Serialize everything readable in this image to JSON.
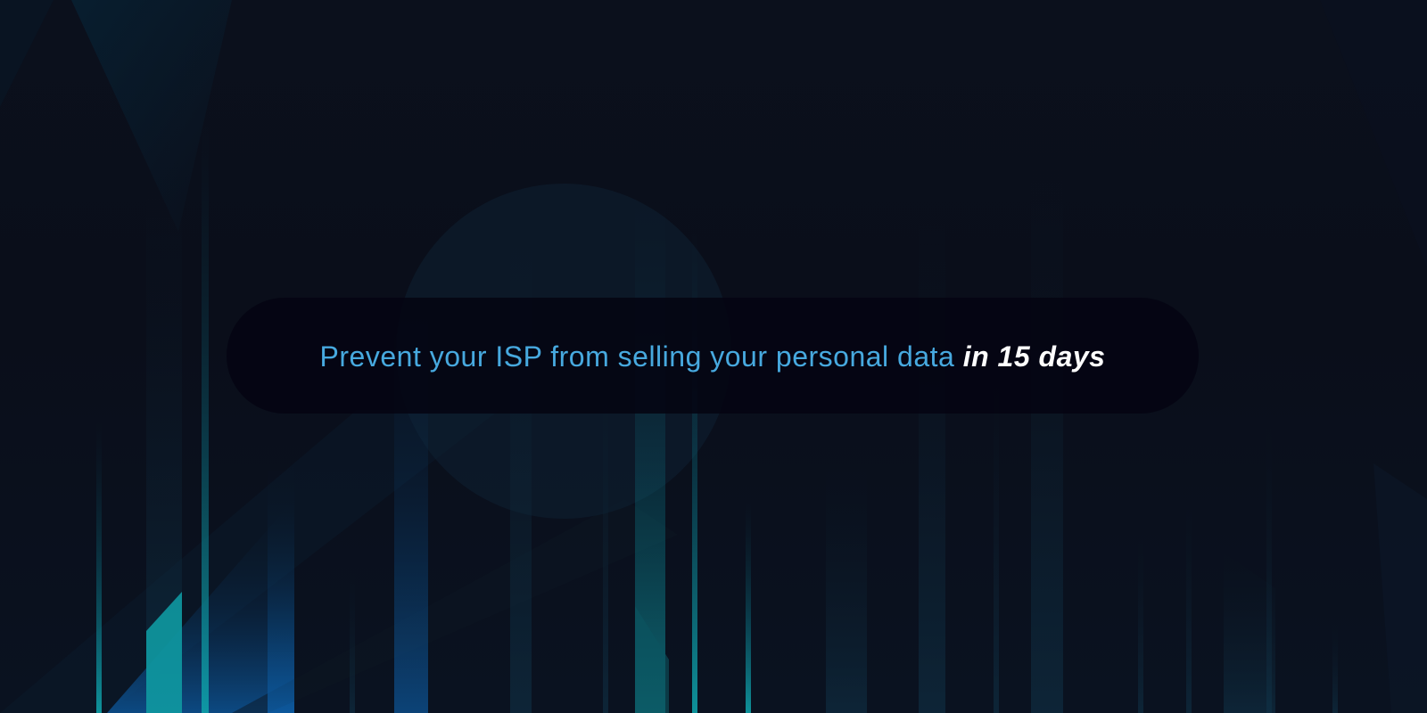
{
  "banner": {
    "headline": "Prevent your ISP from selling your personal data",
    "highlight": "in 15 days"
  },
  "colors": {
    "background": "#0a0d18",
    "pill": "#04050f",
    "headline": "#47a9df",
    "highlight": "#ffffff",
    "accent_teal": "#0fa0a8",
    "accent_blue": "#0d5aa0"
  }
}
